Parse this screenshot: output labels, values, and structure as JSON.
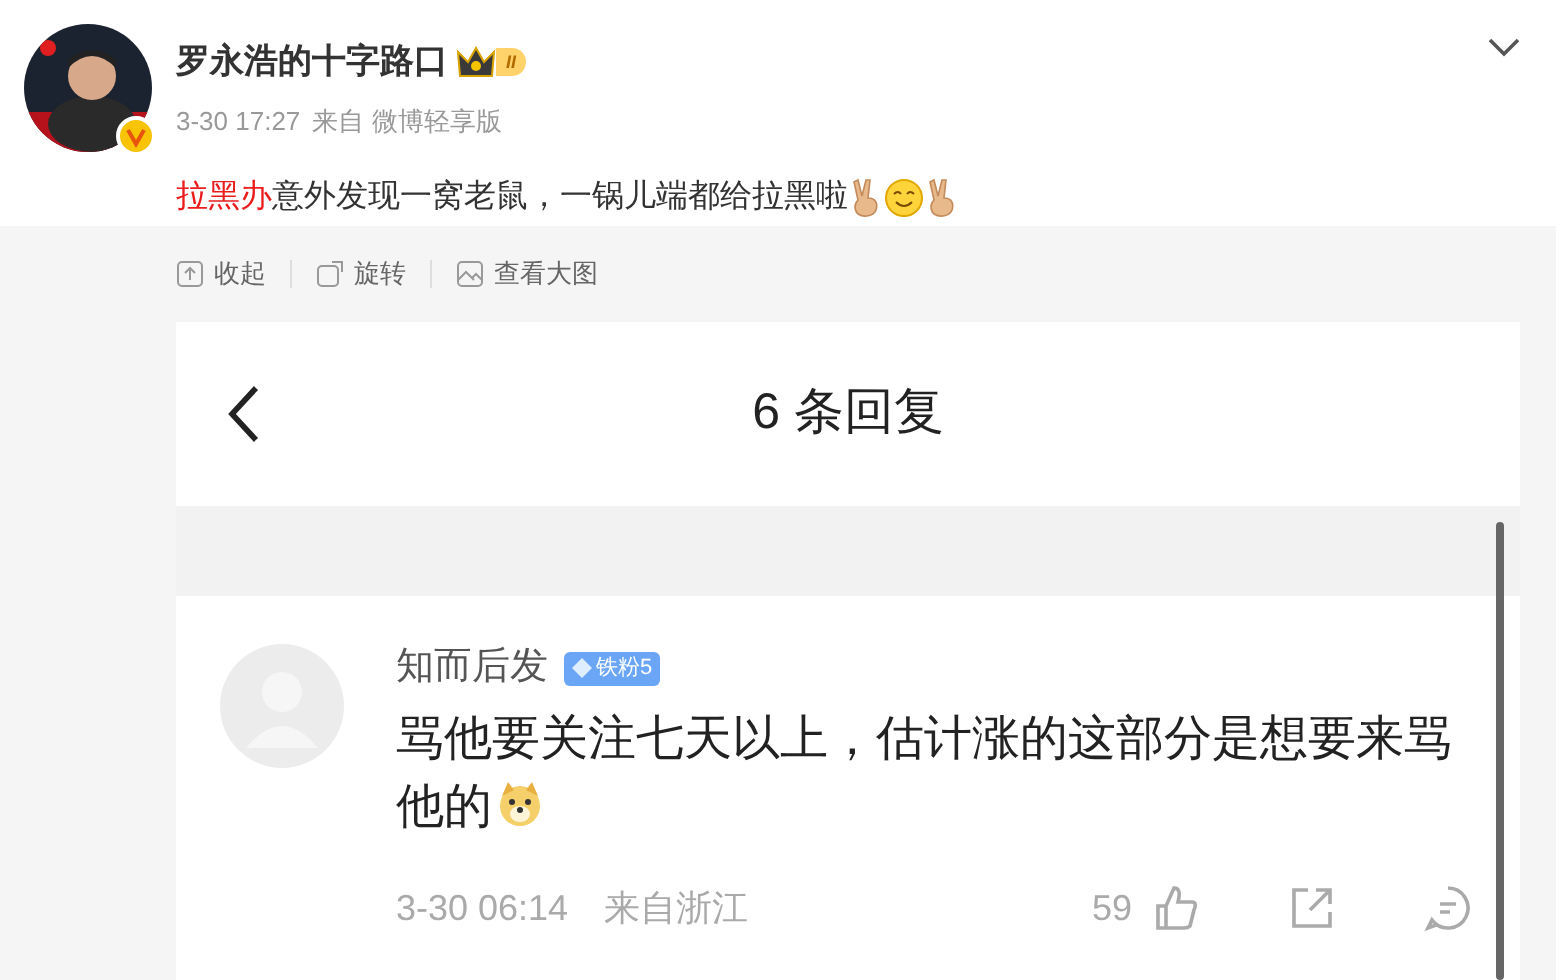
{
  "post": {
    "author": "罗永浩的十字路口",
    "badge": "II",
    "time": "3-30 17:27",
    "source": "来自 微博轻享版",
    "link": "拉黑办",
    "text": "意外发现一窝老鼠，一锅儿端都给拉黑啦"
  },
  "toolbar": [
    "收起",
    "旋转",
    "查看大图"
  ],
  "image": {
    "title": "6 条回复",
    "comment": {
      "author": "知而后发",
      "fan_badge": "铁粉5",
      "text": "骂他要关注七天以上，估计涨的这部分是想要来骂他的",
      "time": "3-30 06:14",
      "location": "来自浙江",
      "likes": "59"
    }
  }
}
